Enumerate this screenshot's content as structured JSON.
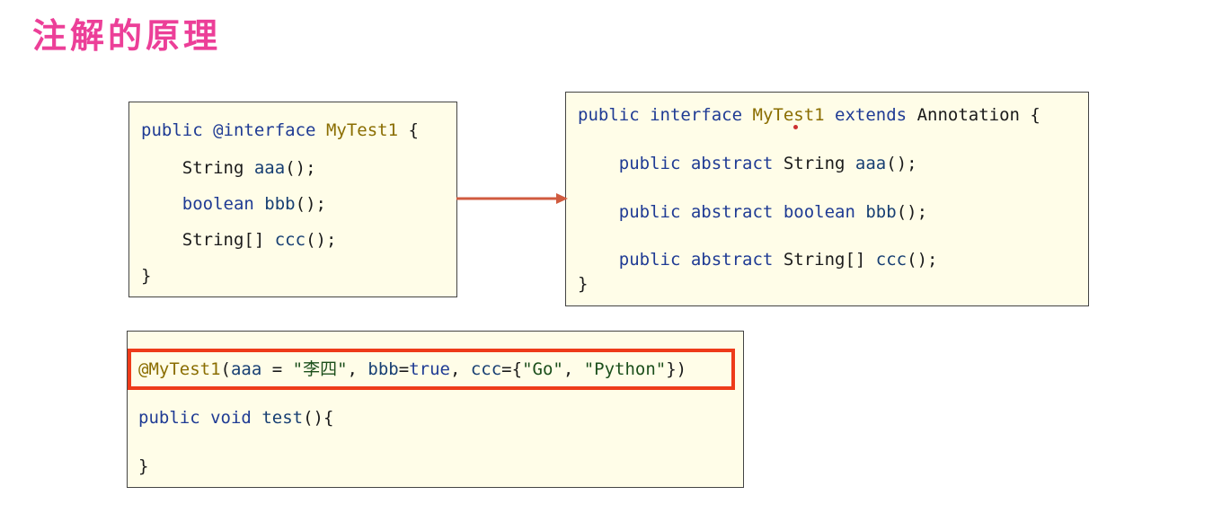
{
  "title": "注解的原理",
  "colors": {
    "title": "#ec3f98",
    "keyword": "#1f3b94",
    "function": "#173f73",
    "annotation": "#8a6d00",
    "string": "#1b4f1b",
    "highlight": "#ee3b1a"
  },
  "left_panel": {
    "lines": [
      "public @interface MyTest1 {",
      "    String aaa();",
      "    boolean bbb();",
      "    String[] ccc();",
      "}"
    ]
  },
  "right_panel": {
    "lines": [
      "public interface MyTest1 extends Annotation {",
      "    public abstract String aaa();",
      "    public abstract boolean bbb();",
      "    public abstract String[] ccc();",
      "}"
    ]
  },
  "bottom_panel": {
    "lines": [
      "@MyTest1(aaa = \"李四\", bbb=true, ccc={\"Go\", \"Python\"})",
      "public void test(){",
      "}"
    ]
  }
}
